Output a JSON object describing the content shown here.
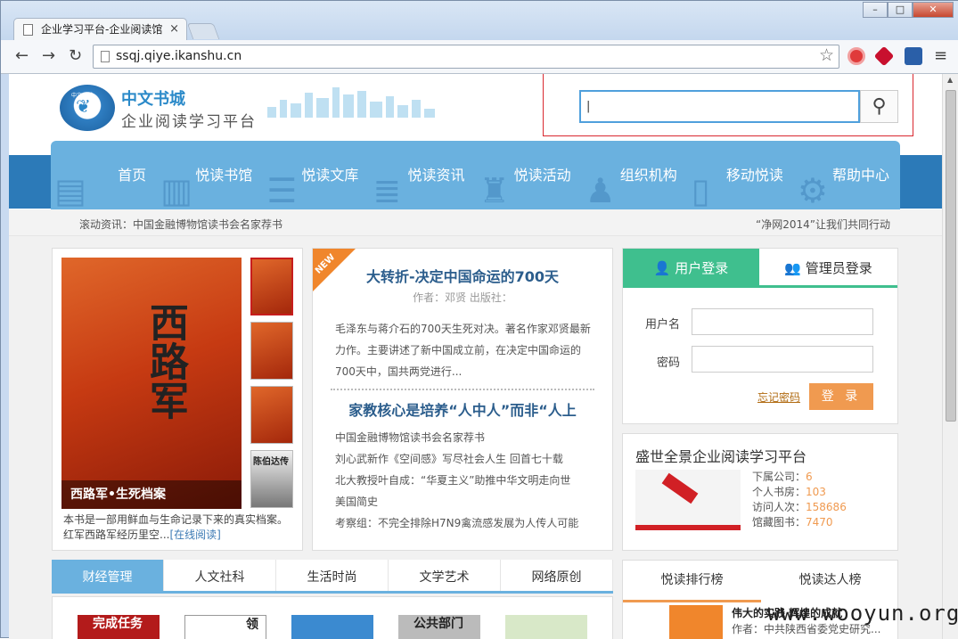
{
  "browser": {
    "tab_title": "企业学习平台-企业阅读馆",
    "url": "ssqj.qiye.ikanshu.cn",
    "window_controls": [
      "minimize-icon",
      "maximize-icon",
      "close-icon"
    ]
  },
  "header": {
    "brand_name": "中文书城",
    "brand_slogan": "企业阅读学习平台",
    "logo_text": "中文书城",
    "search_value": "|"
  },
  "nav": [
    {
      "label": "首页",
      "icon": "book-stack-icon"
    },
    {
      "label": "悦读书馆",
      "icon": "book-icon"
    },
    {
      "label": "悦读文库",
      "icon": "books-icon"
    },
    {
      "label": "悦读资讯",
      "icon": "list-icon"
    },
    {
      "label": "悦读活动",
      "icon": "trophy-icon"
    },
    {
      "label": "组织机构",
      "icon": "people-icon"
    },
    {
      "label": "移动悦读",
      "icon": "mobile-icon"
    },
    {
      "label": "帮助中心",
      "icon": "gear-icon"
    }
  ],
  "ticker": {
    "left": "滚动资讯：中国金融博物馆读书会名家荐书",
    "right": "“净网2014”让我们共同行动"
  },
  "featured": {
    "cover_title": "西路军",
    "cover_caption": "西路军•生死档案",
    "thumb_label": "陈伯达传",
    "desc": "本书是一部用鲜血与生命记录下来的真实档案。红军西路军经历里空...",
    "read_link": "[在线阅读]"
  },
  "news": {
    "badge": "NEW",
    "headline": "大转折-决定中国命运的700天",
    "byline": "作者：邓贤 出版社：",
    "summary": "毛泽东与蒋介石的700天生死对决。著名作家邓贤最新力作。主要讲述了新中国成立前，在决定中国命运的700天中，国共两党进行...",
    "headline2": "家教核心是培养“人中人”而非“人上",
    "items": [
      "中国金融博物馆读书会名家荐书",
      "刘心武新作《空间感》写尽社会人生 回首七十载",
      "北大教授叶自成：“华夏主义”助推中华文明走向世",
      "美国简史",
      "考察组：不完全排除H7N9禽流感发展为人传人可能"
    ]
  },
  "login": {
    "user_tab": "用户登录",
    "admin_tab": "管理员登录",
    "username_label": "用户名",
    "password_label": "密码",
    "forgot": "忘记密码",
    "submit": "登 录"
  },
  "platform": {
    "title": "盛世全景企业阅读学习平台",
    "stats": [
      {
        "label": "下属公司：",
        "value": "6"
      },
      {
        "label": "个人书房：",
        "value": "103"
      },
      {
        "label": "访问人次：",
        "value": "158686"
      },
      {
        "label": "馆藏图书：",
        "value": "7470"
      }
    ]
  },
  "category_tabs": [
    "财经管理",
    "人文社科",
    "生活时尚",
    "文学艺术",
    "网络原创"
  ],
  "books": [
    "完成任务",
    "领",
    "",
    "公共部门",
    ""
  ],
  "ranking": {
    "tabs": [
      "悦读排行榜",
      "悦读达人榜"
    ],
    "item_title": "伟大的实践 辉煌的成就",
    "item_author": "作者：中共陕西省委党史研究..."
  },
  "watermark": "www.wooyun.org",
  "colors": {
    "nav": "#6ab1df",
    "nav_band": "#2c7ab8",
    "login_green": "#3fbf8e",
    "accent_orange": "#f09a50",
    "highlight_red": "#d9282f"
  }
}
